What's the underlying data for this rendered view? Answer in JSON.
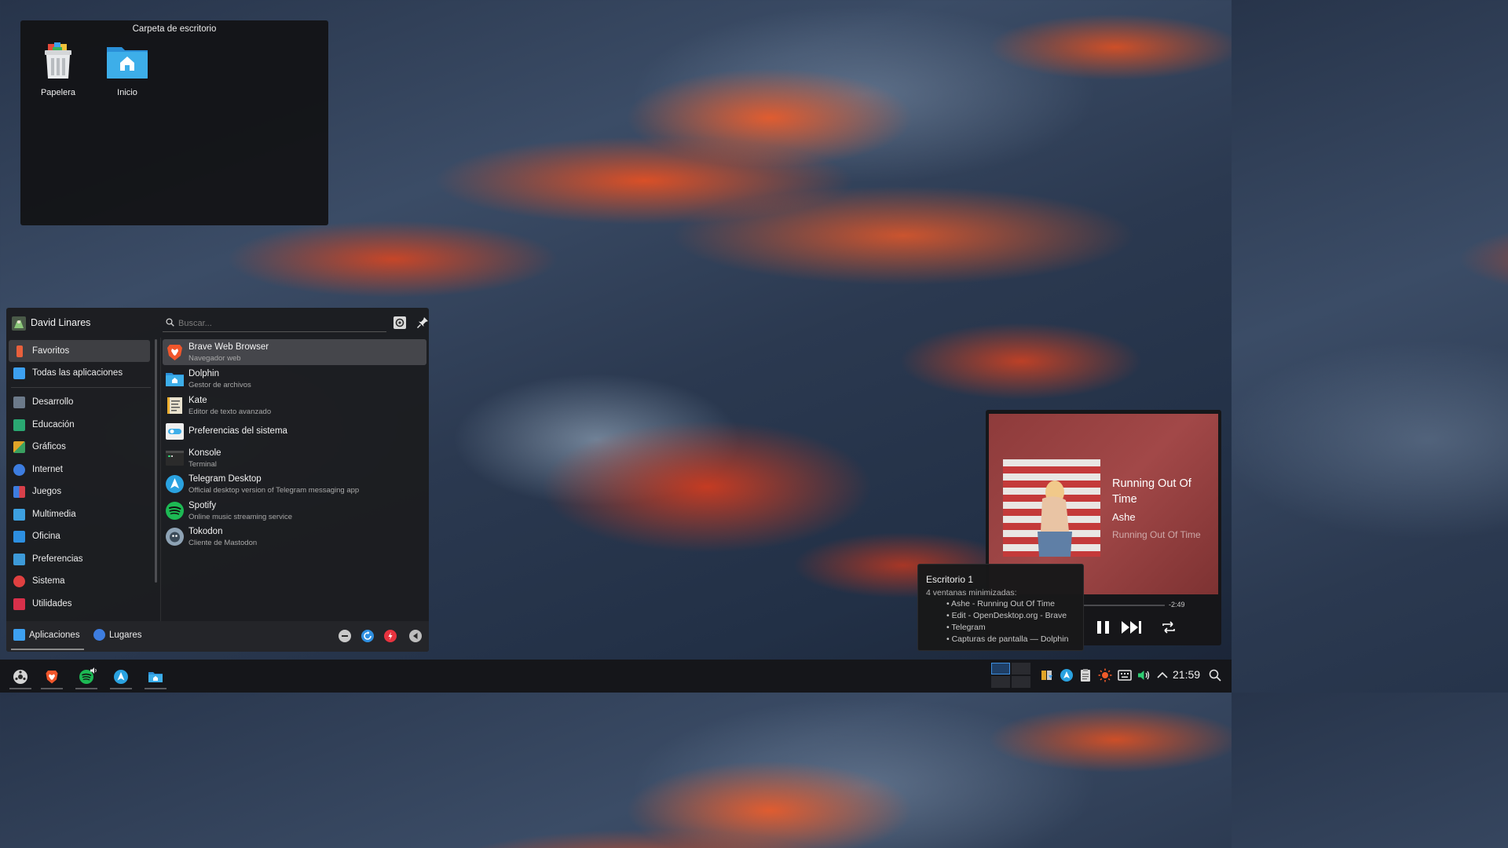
{
  "desktop": {
    "folder_title": "Carpeta de escritorio",
    "icons": [
      {
        "label": "Papelera",
        "icon": "trash-icon"
      },
      {
        "label": "Inicio",
        "icon": "home-folder-icon"
      }
    ]
  },
  "launcher": {
    "user_name": "David Linares",
    "search_placeholder": "Buscar...",
    "categories": [
      {
        "label": "Favoritos",
        "icon": "bookmark-icon",
        "color": "#e8603c"
      },
      {
        "label": "Todas las aplicaciones",
        "icon": "grid-icon",
        "color": "#3da0f0"
      },
      {
        "label": "Desarrollo",
        "icon": "development-icon",
        "color": "#6c7a8a"
      },
      {
        "label": "Educación",
        "icon": "education-icon",
        "color": "#2aa872"
      },
      {
        "label": "Gráficos",
        "icon": "graphics-icon",
        "color": "#e0a428"
      },
      {
        "label": "Internet",
        "icon": "internet-icon",
        "color": "#3d7de0"
      },
      {
        "label": "Juegos",
        "icon": "games-icon",
        "color": "#d8404a"
      },
      {
        "label": "Multimedia",
        "icon": "multimedia-icon",
        "color": "#3da0e0"
      },
      {
        "label": "Oficina",
        "icon": "office-icon",
        "color": "#2d8fe0"
      },
      {
        "label": "Preferencias",
        "icon": "preferences-icon",
        "color": "#3d9ad8"
      },
      {
        "label": "Sistema",
        "icon": "system-icon",
        "color": "#e04040"
      },
      {
        "label": "Utilidades",
        "icon": "utilities-icon",
        "color": "#d8304a"
      }
    ],
    "apps": [
      {
        "name": "Brave Web Browser",
        "desc": "Navegador web",
        "icon": "brave-icon",
        "color": "#f1562b"
      },
      {
        "name": "Dolphin",
        "desc": "Gestor de archivos",
        "icon": "dolphin-icon",
        "color": "#3daee9"
      },
      {
        "name": "Kate",
        "desc": "Editor de texto avanzado",
        "icon": "kate-icon",
        "color": "#e9e2cf"
      },
      {
        "name": "Preferencias del sistema",
        "desc": "",
        "icon": "system-settings-icon",
        "color": "#3daee9"
      },
      {
        "name": "Konsole",
        "desc": "Terminal",
        "icon": "konsole-icon",
        "color": "#2b2b2b"
      },
      {
        "name": "Telegram Desktop",
        "desc": "Official desktop version of Telegram messaging app",
        "icon": "telegram-icon",
        "color": "#2aa2e0"
      },
      {
        "name": "Spotify",
        "desc": "Online music streaming service",
        "icon": "spotify-icon",
        "color": "#1db954"
      },
      {
        "name": "Tokodon",
        "desc": "Cliente de Mastodon",
        "icon": "tokodon-icon",
        "color": "#8ea3b5"
      }
    ],
    "footer": {
      "tab_apps": "Aplicaciones",
      "tab_places": "Lugares"
    }
  },
  "media": {
    "title": "Running Out Of Time",
    "artist": "Ashe",
    "album": "Running Out Of Time",
    "time_remaining": "-2:49"
  },
  "tooltip": {
    "title": "Escritorio 1",
    "subtitle": "4 ventanas minimizadas:",
    "items": [
      "• Ashe - Running Out Of Time",
      "• Edit - OpenDesktop.org - Brave",
      "• Telegram",
      "• Capturas de pantalla — Dolphin"
    ]
  },
  "taskbar": {
    "clock": "21:59"
  }
}
